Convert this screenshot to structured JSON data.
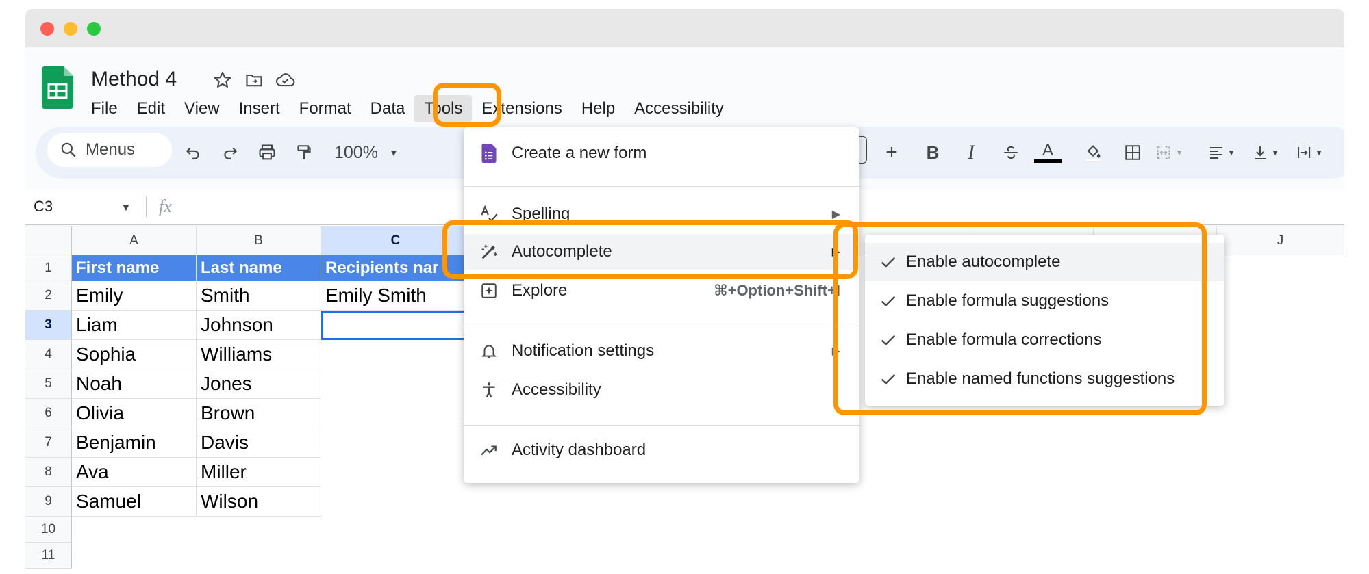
{
  "document": {
    "title": "Method 4"
  },
  "menubar": [
    "File",
    "Edit",
    "View",
    "Insert",
    "Format",
    "Data",
    "Tools",
    "Extensions",
    "Help",
    "Accessibility"
  ],
  "toolbar": {
    "search_label": "Menus",
    "zoom": "100%",
    "bold": "B",
    "italic": "I",
    "text_color": "A"
  },
  "formula_bar": {
    "cell_ref": "C3",
    "fx": "fx"
  },
  "grid": {
    "columns": [
      "A",
      "B",
      "C",
      "J"
    ],
    "rows": [
      "1",
      "2",
      "3",
      "4",
      "5",
      "6",
      "7",
      "8",
      "9",
      "10",
      "11"
    ],
    "header_row": [
      "First name",
      "Last name",
      "Recipients nar"
    ],
    "first_names": [
      "Emily",
      "Liam",
      "Sophia",
      "Noah",
      "Olivia",
      "Benjamin",
      "Ava",
      "Samuel"
    ],
    "last_names": [
      "Smith",
      "Johnson",
      "Williams",
      "Jones",
      "Brown",
      "Davis",
      "Miller",
      "Wilson"
    ],
    "c2": "Emily Smith"
  },
  "tools_menu": {
    "items": [
      {
        "label": "Create a new form",
        "icon": "forms-icon"
      },
      {
        "label": "Spelling",
        "icon": "spellcheck-icon"
      },
      {
        "label": "Autocomplete",
        "icon": "magic-wand-icon"
      },
      {
        "label": "Explore",
        "icon": "explore-icon",
        "shortcut": "⌘+Option+Shift+I"
      },
      {
        "label": "Notification settings",
        "icon": "bell-icon"
      },
      {
        "label": "Accessibility",
        "icon": "accessibility-icon"
      },
      {
        "label": "Activity dashboard",
        "icon": "trending-up-icon"
      }
    ]
  },
  "autocomplete_submenu": {
    "items": [
      {
        "label": "Enable autocomplete",
        "checked": true
      },
      {
        "label": "Enable formula suggestions",
        "checked": true
      },
      {
        "label": "Enable formula corrections",
        "checked": true
      },
      {
        "label": "Enable named functions suggestions",
        "checked": true
      }
    ]
  },
  "colors": {
    "highlight": "#ff9500",
    "header_fill": "#4a86e8",
    "sheets_green": "#0f9d58",
    "forms_purple": "#7248b9"
  }
}
